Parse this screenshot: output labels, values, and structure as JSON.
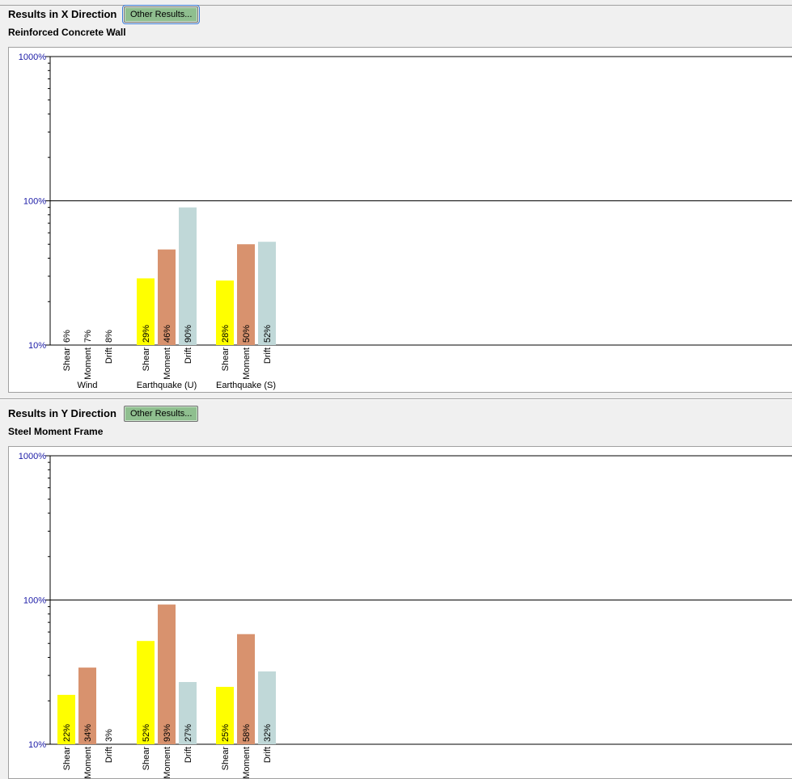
{
  "panels": [
    {
      "title": "Results in X Direction",
      "button_label": "Other Results...",
      "subtitle": "Reinforced Concrete Wall",
      "chart_data": {
        "type": "bar",
        "scale": "log",
        "ylim": [
          10,
          1000
        ],
        "yticks": [
          "10%",
          "100%",
          "1000%"
        ],
        "grid": true,
        "groups": [
          {
            "name": "Wind",
            "bars": [
              {
                "label": "Shear",
                "value": 6,
                "value_label": "6%",
                "color": "#ffff00"
              },
              {
                "label": "Moment",
                "value": 7,
                "value_label": "7%",
                "color": "#d8926e"
              },
              {
                "label": "Drift",
                "value": 8,
                "value_label": "8%",
                "color": "#c0d8d8"
              }
            ]
          },
          {
            "name": "Earthquake (U)",
            "bars": [
              {
                "label": "Shear",
                "value": 29,
                "value_label": "29%",
                "color": "#ffff00"
              },
              {
                "label": "Moment",
                "value": 46,
                "value_label": "46%",
                "color": "#d8926e"
              },
              {
                "label": "Drift",
                "value": 90,
                "value_label": "90%",
                "color": "#c0d8d8"
              }
            ]
          },
          {
            "name": "Earthquake (S)",
            "bars": [
              {
                "label": "Shear",
                "value": 28,
                "value_label": "28%",
                "color": "#ffff00"
              },
              {
                "label": "Moment",
                "value": 50,
                "value_label": "50%",
                "color": "#d8926e"
              },
              {
                "label": "Drift",
                "value": 52,
                "value_label": "52%",
                "color": "#c0d8d8"
              }
            ]
          }
        ]
      }
    },
    {
      "title": "Results in Y Direction",
      "button_label": "Other Results...",
      "subtitle": "Steel Moment Frame",
      "chart_data": {
        "type": "bar",
        "scale": "log",
        "ylim": [
          10,
          1000
        ],
        "yticks": [
          "10%",
          "100%",
          "1000%"
        ],
        "grid": true,
        "groups": [
          {
            "name": "Wind",
            "bars": [
              {
                "label": "Shear",
                "value": 22,
                "value_label": "22%",
                "color": "#ffff00"
              },
              {
                "label": "Moment",
                "value": 34,
                "value_label": "34%",
                "color": "#d8926e"
              },
              {
                "label": "Drift",
                "value": 3,
                "value_label": "3%",
                "color": "#c0d8d8"
              }
            ]
          },
          {
            "name": "Earthquake (U)",
            "bars": [
              {
                "label": "Shear",
                "value": 52,
                "value_label": "52%",
                "color": "#ffff00"
              },
              {
                "label": "Moment",
                "value": 93,
                "value_label": "93%",
                "color": "#d8926e"
              },
              {
                "label": "Drift",
                "value": 27,
                "value_label": "27%",
                "color": "#c0d8d8"
              }
            ]
          },
          {
            "name": "Earthquake (S)",
            "bars": [
              {
                "label": "Shear",
                "value": 25,
                "value_label": "25%",
                "color": "#ffff00"
              },
              {
                "label": "Moment",
                "value": 58,
                "value_label": "58%",
                "color": "#d8926e"
              },
              {
                "label": "Drift",
                "value": 32,
                "value_label": "32%",
                "color": "#c0d8d8"
              }
            ]
          }
        ]
      }
    }
  ],
  "colors": {
    "tick_label": "#1a1aa6",
    "button_bg": "#8fbf8f"
  }
}
